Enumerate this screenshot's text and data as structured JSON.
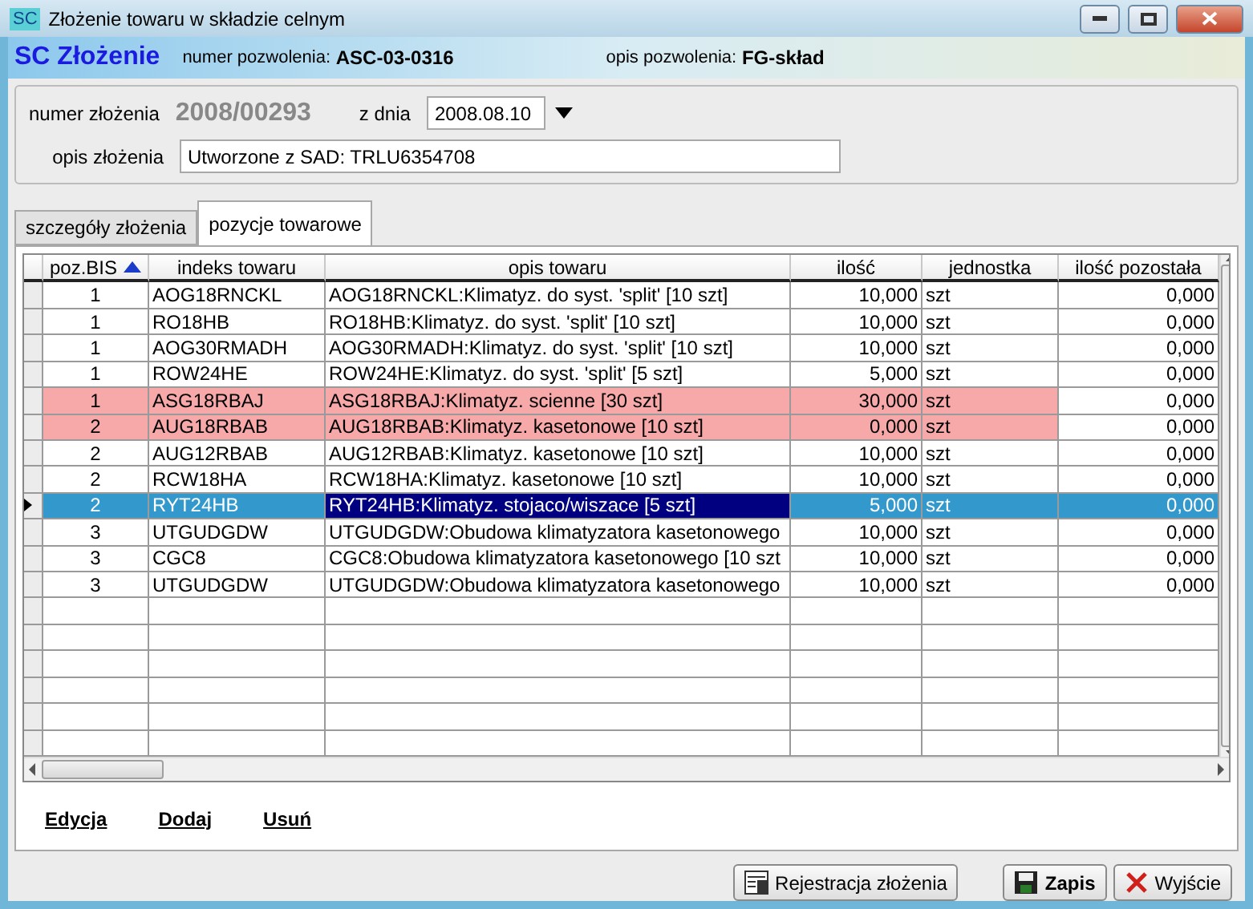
{
  "window": {
    "icon": "SC",
    "title": "Złożenie towaru w składzie celnym"
  },
  "header": {
    "title": "SC Złożenie",
    "permit_label": "numer pozwolenia:",
    "permit_value": "ASC-03-0316",
    "desc_label": "opis pozwolenia:",
    "desc_value": "FG-skład"
  },
  "form": {
    "number_label": "numer złożenia",
    "number_value": "2008/00293",
    "date_label": "z dnia",
    "date_value": "2008.08.10",
    "desc_label": "opis złożenia",
    "desc_value": "Utworzone z SAD: TRLU6354708"
  },
  "tabs": [
    {
      "label": "szczegóły złożenia",
      "selected": false
    },
    {
      "label": "pozycje towarowe",
      "selected": true
    }
  ],
  "table": {
    "columns": [
      {
        "label": "poz.BIS",
        "sorted": true
      },
      {
        "label": "indeks towaru",
        "sorted": false
      },
      {
        "label": "opis towaru",
        "sorted": false
      },
      {
        "label": "ilość",
        "sorted": false
      },
      {
        "label": "jednostka",
        "sorted": false
      },
      {
        "label": "ilość pozostała",
        "sorted": false
      }
    ],
    "rows": [
      {
        "cells": [
          "1",
          "AOG18RNCKL",
          "AOG18RNCKL:Klimatyz. do syst. 'split' [10 szt]",
          "10,000",
          "szt",
          "0,000"
        ],
        "warning": false,
        "selected": false
      },
      {
        "cells": [
          "1",
          "RO18HB",
          "RO18HB:Klimatyz. do syst. 'split' [10 szt]",
          "10,000",
          "szt",
          "0,000"
        ],
        "warning": false,
        "selected": false
      },
      {
        "cells": [
          "1",
          "AOG30RMADH",
          "AOG30RMADH:Klimatyz. do syst. 'split' [10 szt]",
          "10,000",
          "szt",
          "0,000"
        ],
        "warning": false,
        "selected": false
      },
      {
        "cells": [
          "1",
          "ROW24HE",
          "ROW24HE:Klimatyz. do syst. 'split' [5 szt]",
          "5,000",
          "szt",
          "0,000"
        ],
        "warning": false,
        "selected": false
      },
      {
        "cells": [
          "1",
          "ASG18RBAJ",
          "ASG18RBAJ:Klimatyz. scienne [30 szt]",
          "30,000",
          "szt",
          "0,000"
        ],
        "warning": true,
        "selected": false
      },
      {
        "cells": [
          "2",
          "AUG18RBAB",
          "AUG18RBAB:Klimatyz. kasetonowe [10 szt]",
          "0,000",
          "szt",
          "0,000"
        ],
        "warning": true,
        "selected": false
      },
      {
        "cells": [
          "2",
          "AUG12RBAB",
          "AUG12RBAB:Klimatyz. kasetonowe [10 szt]",
          "10,000",
          "szt",
          "0,000"
        ],
        "warning": false,
        "selected": false
      },
      {
        "cells": [
          "2",
          "RCW18HA",
          "RCW18HA:Klimatyz. kasetonowe [10 szt]",
          "10,000",
          "szt",
          "0,000"
        ],
        "warning": false,
        "selected": false
      },
      {
        "cells": [
          "2",
          "RYT24HB",
          "RYT24HB:Klimatyz. stojaco/wiszace [5 szt]",
          "5,000",
          "szt",
          "0,000"
        ],
        "warning": false,
        "selected": true
      },
      {
        "cells": [
          "3",
          "UTGUDGDW",
          "UTGUDGDW:Obudowa klimatyzatora kasetonowego",
          "10,000",
          "szt",
          "0,000"
        ],
        "warning": false,
        "selected": false
      },
      {
        "cells": [
          "3",
          "CGC8",
          "CGC8:Obudowa klimatyzatora kasetonowego [10 szt",
          "10,000",
          "szt",
          "0,000"
        ],
        "warning": false,
        "selected": false
      },
      {
        "cells": [
          "3",
          "UTGUDGDW",
          "UTGUDGDW:Obudowa klimatyzatora kasetonowego",
          "10,000",
          "szt",
          "0,000"
        ],
        "warning": false,
        "selected": false
      }
    ]
  },
  "links": [
    "Edycja",
    "Dodaj",
    "Usuń"
  ],
  "buttons": [
    {
      "label": "Rejestracja złożenia",
      "kind": "register"
    },
    {
      "label": "Zapis",
      "kind": "save"
    },
    {
      "label": "Wyjście",
      "kind": "exit"
    }
  ]
}
